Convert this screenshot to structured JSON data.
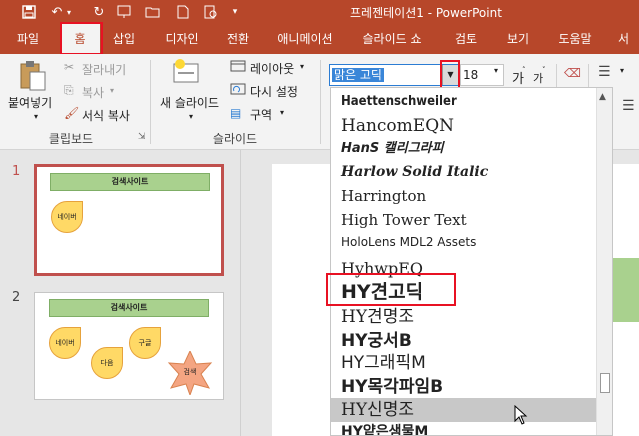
{
  "window": {
    "title": "프레젠테이션1 - PowerPoint"
  },
  "tabs": [
    "파일",
    "홈",
    "삽입",
    "디자인",
    "전환",
    "애니메이션",
    "슬라이드 쇼",
    "검토",
    "보기",
    "도움말",
    "서"
  ],
  "ribbon": {
    "paste": "붙여넣기",
    "cut": "잘라내기",
    "copy": "복사",
    "format_painter": "서식 복사",
    "clipboard_group": "클립보드",
    "new_slide": "새 슬라이드",
    "layout": "레이아웃",
    "reset": "다시 설정",
    "section": "구역",
    "slides_group": "슬라이드",
    "font_name": "맑은 고딕",
    "font_size": "18",
    "grow_font": "가",
    "shrink_font": "가"
  },
  "font_list": [
    "Haettenschweiler",
    "HancomEQN",
    "HanS 캘리그라피",
    "Harlow Solid Italic",
    "Harrington",
    "High Tower Text",
    "HoloLens MDL2 Assets",
    "HyhwpEQ",
    "HY견고딕",
    "HY견명조",
    "HY궁서B",
    "HY그래픽M",
    "HY목각파임B",
    "HY신명조",
    "HY얕은샘물M"
  ],
  "slides": [
    {
      "number": "1",
      "title": "검색사이트",
      "shapes": [
        "네이버"
      ]
    },
    {
      "number": "2",
      "title": "검색사이트",
      "shapes": [
        "네이버",
        "다음",
        "구글",
        "검색"
      ]
    }
  ],
  "colors": {
    "accent": "#b7472a",
    "highlight_box": "#e81123",
    "slide_title_fill": "#a9d18e",
    "shape_fill": "#ffd966",
    "star_fill": "#f4a582"
  }
}
